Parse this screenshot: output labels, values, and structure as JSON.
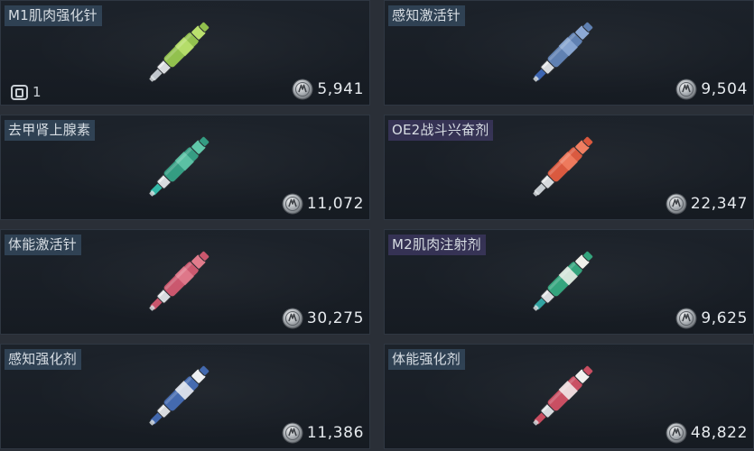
{
  "items": [
    {
      "name": "M1肌肉强化针",
      "price": "5,941",
      "count": "1",
      "colors": {
        "body": "#8fbf49",
        "accent": "#b9e06a",
        "tip": "#bfc5cb"
      }
    },
    {
      "name": "感知激活针",
      "price": "9,504",
      "colors": {
        "body": "#5b7db0",
        "accent": "#8aa7d4",
        "tip": "#3a63b0"
      }
    },
    {
      "name": "去甲肾上腺素",
      "price": "11,072",
      "colors": {
        "body": "#2f9a7f",
        "accent": "#5cc6a7",
        "tip": "#2fb7a6"
      }
    },
    {
      "name": "OE2战斗兴奋剂",
      "price": "22,347",
      "colors": {
        "body": "#d9553a",
        "accent": "#f07b5d",
        "tip": "#c5cbd0"
      }
    },
    {
      "name": "体能激活针",
      "price": "30,275",
      "colors": {
        "body": "#c9536a",
        "accent": "#e07889",
        "tip": "#c9536a"
      }
    },
    {
      "name": "M2肌肉注射剂",
      "price": "9,625",
      "colors": {
        "body": "#2fa27a",
        "accent": "#f0f0ea",
        "tip": "#2fa2a0"
      }
    },
    {
      "name": "感知强化剂",
      "price": "11,386",
      "colors": {
        "body": "#3f66ad",
        "accent": "#eef0f2",
        "tip": "#3f66ad"
      }
    },
    {
      "name": "体能强化剂",
      "price": "48,822",
      "colors": {
        "body": "#c84a5e",
        "accent": "#f2f0ee",
        "tip": "#c84a5e"
      }
    }
  ],
  "icons": {
    "currency": "silver-coin-icon",
    "count": "stack-count-icon"
  }
}
